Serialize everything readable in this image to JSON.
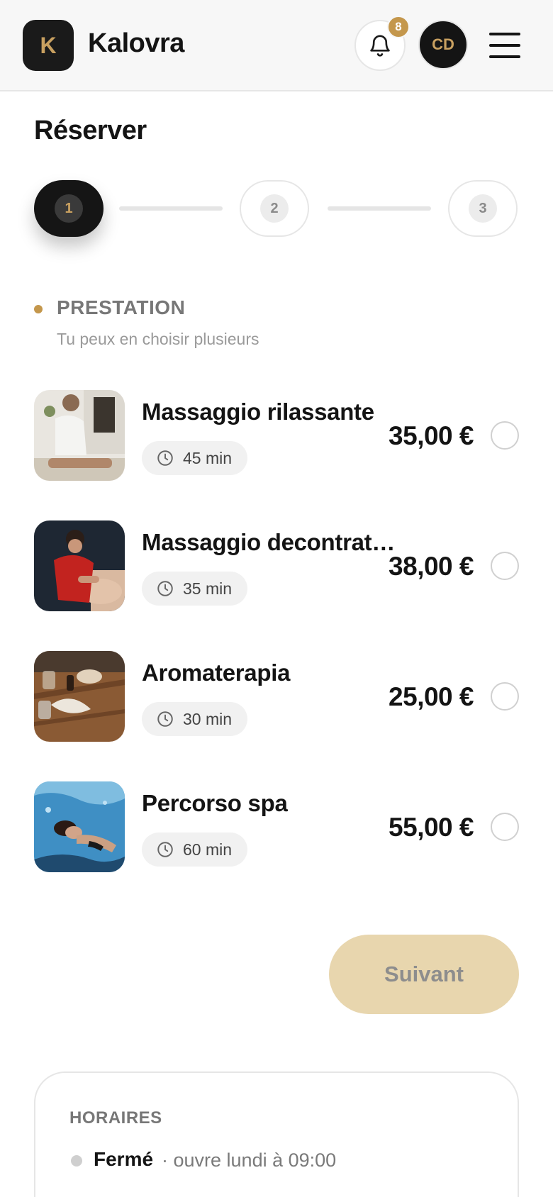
{
  "header": {
    "logo_letter": "K",
    "brand": "Kalovra",
    "notification_count": "8",
    "avatar_initials": "CD"
  },
  "page_title": "Réserver",
  "stepper": {
    "steps": [
      "1",
      "2",
      "3"
    ],
    "active_step": 1
  },
  "section": {
    "title": "PRESTATION",
    "subtitle": "Tu peux en choisir plusieurs"
  },
  "services": [
    {
      "name": "Massaggio rilassante",
      "duration": "45 min",
      "price": "35,00 €",
      "selected": false,
      "image": "massage-photo"
    },
    {
      "name": "Massaggio decontratturante",
      "duration": "35 min",
      "price": "38,00 €",
      "selected": false,
      "image": "deep-massage-photo"
    },
    {
      "name": "Aromaterapia",
      "duration": "30 min",
      "price": "25,00 €",
      "selected": false,
      "image": "aromatherapy-photo"
    },
    {
      "name": "Percorso spa",
      "duration": "60 min",
      "price": "55,00 €",
      "selected": false,
      "image": "spa-pool-photo"
    }
  ],
  "next_button": "Suivant",
  "hours": {
    "title": "HORAIRES",
    "status": "Fermé",
    "next_open": "· ouvre lundi à 09:00"
  },
  "colors": {
    "accent": "#c4974c",
    "dark": "#141414",
    "button_disabled": "#e8d6ae"
  }
}
